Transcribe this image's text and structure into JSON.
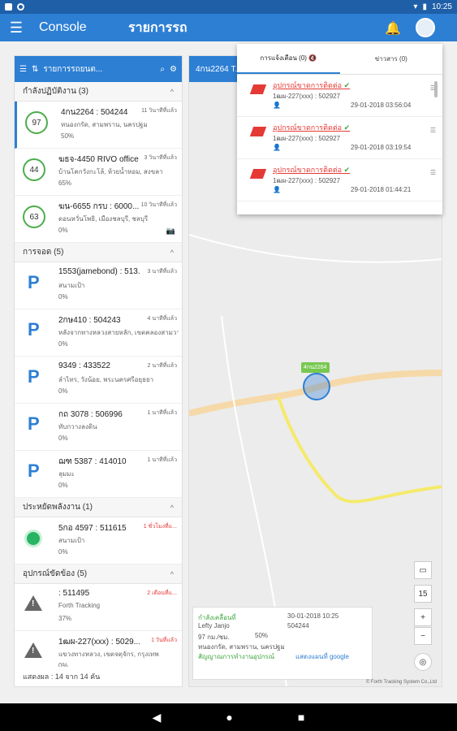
{
  "status_bar": {
    "time": "10:25"
  },
  "appbar": {
    "console": "Console",
    "title": "รายการรถ"
  },
  "panel": {
    "search_label": "รายการรถยนต...",
    "sections": [
      {
        "title": "กำลังปฏิบัติงาน (3)",
        "items": [
          {
            "badge": "97",
            "name": "4กน2264 : 504244",
            "time": "11 วินาทีที่แล้ว",
            "loc": "หนองกรัด, สามพราน, นครปฐม",
            "fuel": "50%"
          },
          {
            "badge": "44",
            "name": "ฆธจ-4450 RIVO office ...",
            "time": "3 วินาทีที่แล้ว",
            "loc": "บ้านโคกวังกะโล้, ห้วยน้ำหอม, สงขลา",
            "fuel": "65%"
          },
          {
            "badge": "63",
            "name": "ฆน-6655 กรบ : 6000...",
            "time": "10 วินาทีที่แล้ว",
            "loc": "ดอนหวั่นโพธิ, เมืองชลบุรี, ชลบุรี",
            "fuel": "0%"
          }
        ]
      },
      {
        "title": "การจอด (5)",
        "items": [
          {
            "name": "1553(jamebond) : 513...",
            "time": "3 นาทีที่แล้ว",
            "loc": "สนามเป้า",
            "fuel": "0%"
          },
          {
            "name": "2กษ410 : 504243",
            "time": "4 นาทีที่แล้ว",
            "loc": "หลังจากทางหลวงสายหลัก, เขตคลองสามวา",
            "fuel": "0%"
          },
          {
            "name": "9349 : 433522",
            "time": "2 นาทีที่แล้ว",
            "loc": "ลำไทร, วังน้อย, พระนครศรีอยุธยา",
            "fuel": "0%"
          },
          {
            "name": "กถ 3078 : 506996",
            "time": "1 นาทีที่แล้ว",
            "loc": "ทับกวางลงดิน",
            "fuel": "0%"
          },
          {
            "name": "ฌฑ 5387 : 414010",
            "time": "1 นาทีที่แล้ว",
            "loc": "ลุมมะ",
            "fuel": "0%"
          }
        ]
      },
      {
        "title": "ประหยัดพลังงาน (1)",
        "items": [
          {
            "name": "5กอ 4597 : 511615",
            "time": "1 ชั่วโมงที่แ...",
            "loc": "สนามเป้า",
            "fuel": "0%"
          }
        ]
      },
      {
        "title": "อุปกรณ์ขัดข้อง (5)",
        "items": [
          {
            "name": ": 511495",
            "time": "2 เดือนที่แ...",
            "loc": "Forth Tracking",
            "fuel": "37%"
          },
          {
            "name": "1ฒผ-227(xxx) : 5029...",
            "time": "1 วันที่แล้ว",
            "loc": "แขวงทางหลวง, เขตจตุจักร, กรุงเทพ",
            "fuel": "0%"
          }
        ]
      }
    ],
    "footer": "แสดงผล : 14 จาก 14 คัน"
  },
  "map": {
    "header": "4กน2264 T...",
    "car_label": "4กน2264",
    "zoom_level": "15",
    "info": {
      "status": "กำลังเคลื่อนที่",
      "datetime": "30-01-2018 10:25",
      "driver": "Lefty Janjo",
      "code": "504244",
      "speed": "97 กม./ชม.",
      "fuel": "50%",
      "loc": "หนองกรัด, สามพราน, นครปฐม",
      "link1": "สัญญาณการทำงานอุปกรณ์",
      "link2": "แสดงแผนที่ google"
    },
    "copyright": "© Forth Tracking System Co.,Ltd"
  },
  "popup": {
    "tab1": "การแจ้งเตือน (0) 🔇",
    "tab2": "ข่าวสาร (0)",
    "notifications": [
      {
        "title": "อุปกรณ์ขาดการติดต่อ",
        "vehicle": "1ฒผ-227(xxx) : 502927",
        "time": "29-01-2018 03:56:04"
      },
      {
        "title": "อุปกรณ์ขาดการติดต่อ",
        "vehicle": "1ฒผ-227(xxx) : 502927",
        "time": "29-01-2018 03:19:54"
      },
      {
        "title": "อุปกรณ์ขาดการติดต่อ",
        "vehicle": "1ฒผ-227(xxx) : 502927",
        "time": "29-01-2018 01:44:21"
      }
    ]
  }
}
